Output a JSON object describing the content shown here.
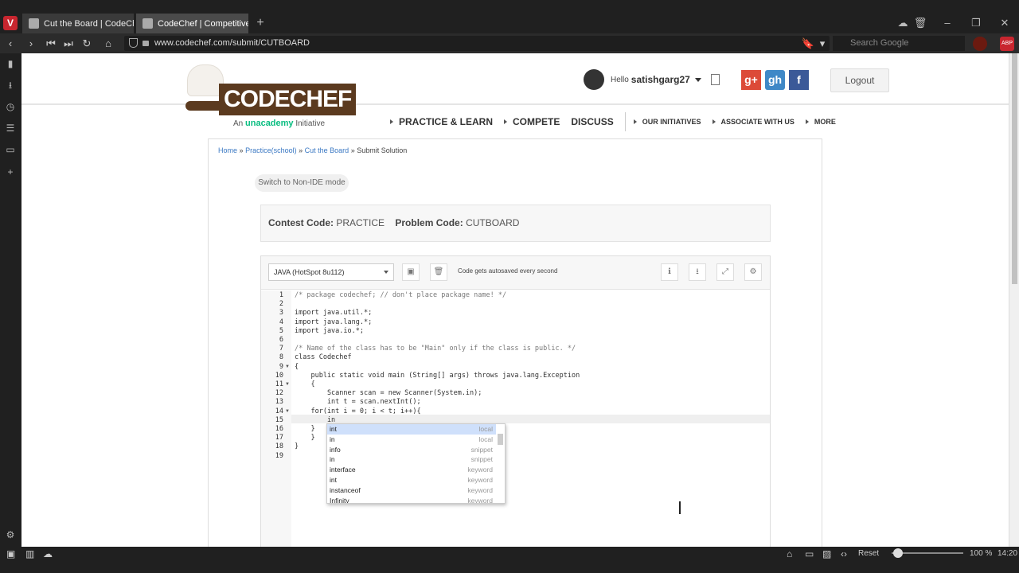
{
  "browser": {
    "tabs": [
      {
        "title": "Cut the Board | CodeChef"
      },
      {
        "title": "CodeChef | Competitive Pr"
      }
    ],
    "url": "www.codechef.com/submit/CUTBOARD",
    "search_placeholder": "Search Google",
    "status": {
      "reset": "Reset",
      "zoom": "100 %",
      "time": "14:20"
    }
  },
  "site": {
    "logo_text": "CODECHEF",
    "logo_sub_prefix": "An",
    "logo_sub_brand": "unacademy",
    "logo_sub_suffix": "Initiative",
    "hello": "Hello",
    "username": "satishgarg27",
    "logout": "Logout",
    "social": [
      "g+",
      "gh",
      "f"
    ],
    "nav": {
      "main": [
        "PRACTICE & LEARN",
        "COMPETE",
        "DISCUSS"
      ],
      "secondary": [
        "OUR INITIATIVES",
        "ASSOCIATE WITH US",
        "MORE"
      ]
    }
  },
  "breadcrumb": {
    "home": "Home",
    "practice": "Practice(school)",
    "problem": "Cut the Board",
    "current": "Submit Solution",
    "sep": "»"
  },
  "switch_mode": "Switch to Non-IDE mode",
  "contest": {
    "contest_label": "Contest Code:",
    "contest_value": "PRACTICE",
    "problem_label": "Problem Code:",
    "problem_value": "CUTBOARD"
  },
  "ide": {
    "language": "JAVA (HotSpot 8u112)",
    "autosave": "Code gets autosaved every second",
    "line_numbers": [
      "1",
      "2",
      "3",
      "4",
      "5",
      "6",
      "7",
      "8",
      "9",
      "10",
      "11",
      "12",
      "13",
      "14",
      "15",
      "16",
      "17",
      "18",
      "19"
    ],
    "code_lines": [
      "/* package codechef; // don't place package name! */",
      "",
      "import java.util.*;",
      "import java.lang.*;",
      "import java.io.*;",
      "",
      "/* Name of the class has to be \"Main\" only if the class is public. */",
      "class Codechef",
      "{",
      "    public static void main (String[] args) throws java.lang.Exception",
      "    {",
      "        Scanner scan = new Scanner(System.in);",
      "        int t = scan.nextInt();",
      "    for(int i = 0; i < t; i++){",
      "        in",
      "    }",
      "    }",
      "}",
      ""
    ],
    "autocomplete": [
      {
        "word": "int",
        "type": "local"
      },
      {
        "word": "in",
        "type": "local"
      },
      {
        "word": "info",
        "type": "snippet"
      },
      {
        "word": "in",
        "type": "snippet"
      },
      {
        "word": "interface",
        "type": "keyword"
      },
      {
        "word": "int",
        "type": "keyword"
      },
      {
        "word": "instanceof",
        "type": "keyword"
      },
      {
        "word": "Infinity",
        "type": "keyword"
      }
    ]
  },
  "colors": {
    "brand_brown": "#5b3a1f",
    "unacademy_green": "#08bd80",
    "google": "#dc4a38",
    "github": "#3f88c7",
    "facebook": "#3b5998",
    "autocomplete_selected": "#cfe0fb"
  }
}
